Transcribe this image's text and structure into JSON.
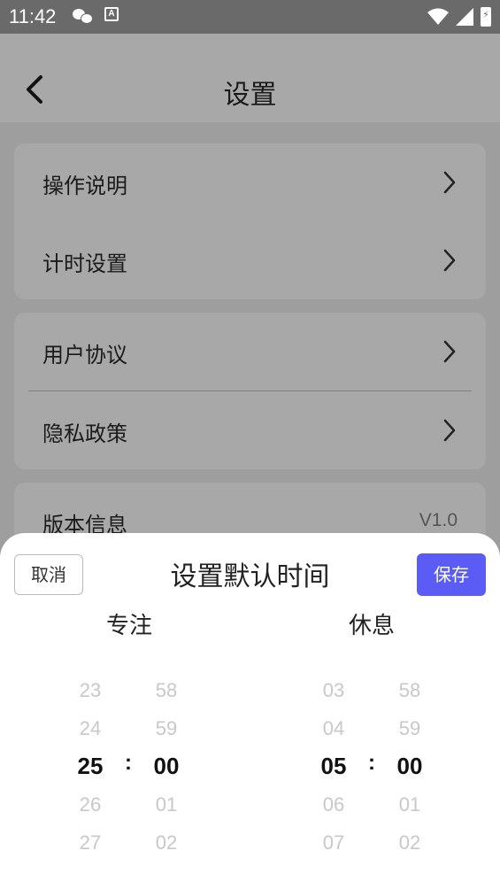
{
  "status_bar": {
    "time": "11:42",
    "app_icon_letter": "A"
  },
  "nav": {
    "title": "设置"
  },
  "settings": {
    "group1": [
      {
        "label": "操作说明"
      },
      {
        "label": "计时设置"
      }
    ],
    "group2": [
      {
        "label": "用户协议"
      },
      {
        "label": "隐私政策"
      }
    ],
    "version": {
      "label": "版本信息",
      "value": "V1.0"
    }
  },
  "sheet": {
    "title": "设置默认时间",
    "cancel_label": "取消",
    "save_label": "保存",
    "focus_header": "专注",
    "rest_header": "休息",
    "separator": ":",
    "focus_minutes": [
      "23",
      "24",
      "25",
      "26",
      "27"
    ],
    "focus_seconds": [
      "58",
      "59",
      "00",
      "01",
      "02"
    ],
    "rest_minutes": [
      "03",
      "04",
      "05",
      "06",
      "07"
    ],
    "rest_seconds": [
      "58",
      "59",
      "00",
      "01",
      "02"
    ]
  },
  "colors": {
    "accent": "#5a5cf5",
    "overlay_bg": "#9e9e9e"
  }
}
